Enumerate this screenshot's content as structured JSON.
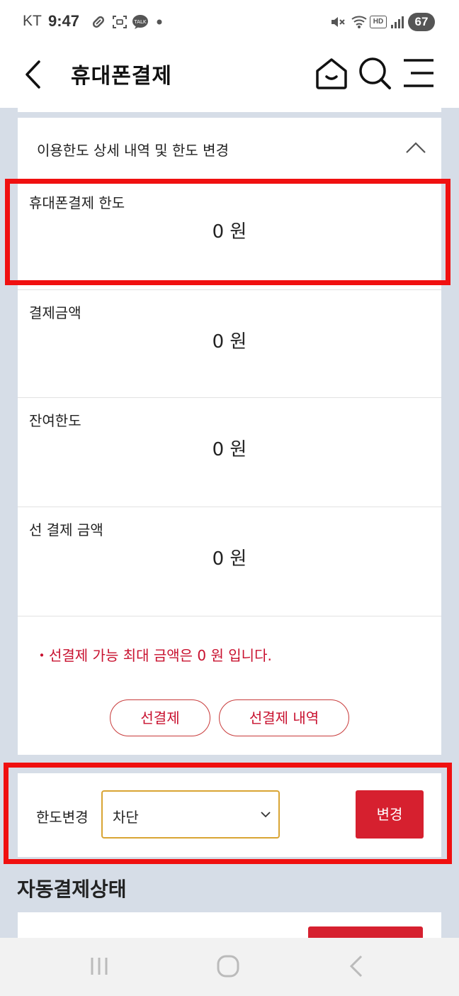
{
  "status_bar": {
    "carrier": "KT",
    "time": "9:47",
    "battery": "67",
    "hd_badge": "HD"
  },
  "header": {
    "title": "휴대폰결제"
  },
  "accordion": {
    "title": "이용한도 상세 내역 및 한도 변경",
    "rows": [
      {
        "label": "휴대폰결제 한도",
        "value": "0 원"
      },
      {
        "label": "결제금액",
        "value": "0 원"
      },
      {
        "label": "잔여한도",
        "value": "0 원"
      },
      {
        "label": "선 결제 금액",
        "value": "0 원"
      }
    ],
    "notice": "・선결제 가능 최대 금액은 0 원 입니다.",
    "prepay_button": "선결제",
    "prepay_history_button": "선결제 내역"
  },
  "limit_change": {
    "label": "한도변경",
    "selected": "차단",
    "button": "변경"
  },
  "auto_payment": {
    "section_title": "자동결제상태"
  },
  "colors": {
    "accent_red": "#d6202f",
    "notice_red": "#c8102e",
    "select_border": "#d9a534",
    "highlight_red": "#f01010",
    "background": "#d6dde7"
  },
  "icons": [
    "back-icon",
    "home-icon",
    "search-icon",
    "menu-icon",
    "chevron-up-icon",
    "chevron-down-icon",
    "recents-icon",
    "home-nav-icon",
    "back-nav-icon"
  ]
}
